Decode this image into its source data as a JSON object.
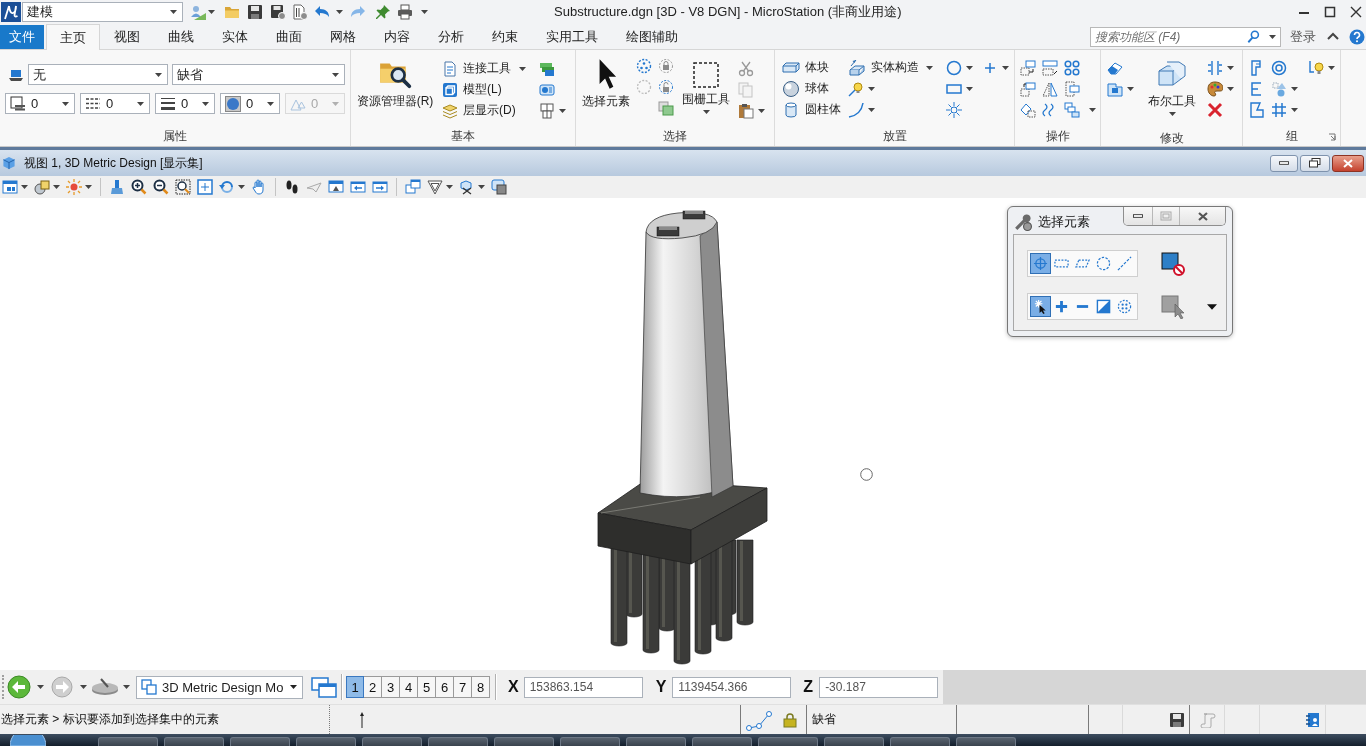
{
  "title_bar": {
    "workspace": "建模",
    "title": "Substructure.dgn [3D - V8 DGN] - MicroStation (非商业用途)"
  },
  "tabs": [
    {
      "label": "文件",
      "kind": "backstage",
      "selected": false
    },
    {
      "label": "主页",
      "kind": "tab",
      "selected": true
    },
    {
      "label": "视图",
      "kind": "tab",
      "selected": false
    },
    {
      "label": "曲线",
      "kind": "tab",
      "selected": false
    },
    {
      "label": "实体",
      "kind": "tab",
      "selected": false
    },
    {
      "label": "曲面",
      "kind": "tab",
      "selected": false
    },
    {
      "label": "网格",
      "kind": "tab",
      "selected": false
    },
    {
      "label": "内容",
      "kind": "tab",
      "selected": false
    },
    {
      "label": "分析",
      "kind": "tab",
      "selected": false
    },
    {
      "label": "约束",
      "kind": "tab",
      "selected": false
    },
    {
      "label": "实用工具",
      "kind": "tab",
      "selected": false
    },
    {
      "label": "绘图辅助",
      "kind": "tab",
      "selected": false
    }
  ],
  "ribbon_search": {
    "placeholder": "搜索功能区 (F4)"
  },
  "sign_in": "登录",
  "ribbon": {
    "attributes": {
      "label": "属性",
      "level": "无",
      "style": "缺省",
      "fields": [
        {
          "kind": "color",
          "value": "0",
          "disabled": false
        },
        {
          "kind": "style",
          "value": "0",
          "disabled": false
        },
        {
          "kind": "weight",
          "value": "0",
          "disabled": false
        },
        {
          "kind": "transparency",
          "value": "0",
          "disabled": false
        },
        {
          "kind": "priority",
          "value": "0",
          "disabled": true
        }
      ]
    },
    "primary": {
      "label": "基本",
      "explorer": "资源管理器(R)",
      "attach_tools": "连接工具",
      "models": "模型(L)",
      "level_display": "层显示(D)"
    },
    "selection": {
      "label": "选择",
      "select_element": "选择元素",
      "fence_tools": "围栅工具"
    },
    "placement": {
      "label": "放置",
      "block": "体块",
      "sphere": "球体",
      "cylinder": "圆柱体",
      "solid_construct": "实体构造"
    },
    "manipulate": {
      "label": "操作"
    },
    "modify": {
      "label": "修改",
      "boolean_tools": "布尔工具"
    },
    "groups": {
      "label": "组"
    }
  },
  "view": {
    "title": "视图 1, 3D Metric Design [显示集]"
  },
  "select_dialog": {
    "title": "选择元素",
    "methods": [
      {
        "kind": "individual",
        "selected": true
      },
      {
        "kind": "block",
        "selected": false
      },
      {
        "kind": "shape",
        "selected": false
      },
      {
        "kind": "circle",
        "selected": false
      },
      {
        "kind": "line",
        "selected": false
      }
    ],
    "modes": [
      {
        "kind": "new",
        "selected": true
      },
      {
        "kind": "add",
        "selected": false
      },
      {
        "kind": "subtract",
        "selected": false
      },
      {
        "kind": "invert",
        "selected": false
      },
      {
        "kind": "all",
        "selected": false
      }
    ]
  },
  "view_control": {
    "model": "3D Metric Design Mo",
    "views": [
      {
        "label": "1",
        "selected": true
      },
      {
        "label": "2",
        "selected": false
      },
      {
        "label": "3",
        "selected": false
      },
      {
        "label": "4",
        "selected": false
      },
      {
        "label": "5",
        "selected": false
      },
      {
        "label": "6",
        "selected": false
      },
      {
        "label": "7",
        "selected": false
      },
      {
        "label": "8",
        "selected": false
      }
    ],
    "coordinates": [
      {
        "axis": "X",
        "value": "153863.154"
      },
      {
        "axis": "Y",
        "value": "1139454.366"
      },
      {
        "axis": "Z",
        "value": "-30.187"
      }
    ]
  },
  "status_bar": {
    "prompt": "选择元素 > 标识要添加到选择集中的元素",
    "active_level": "缺省"
  }
}
